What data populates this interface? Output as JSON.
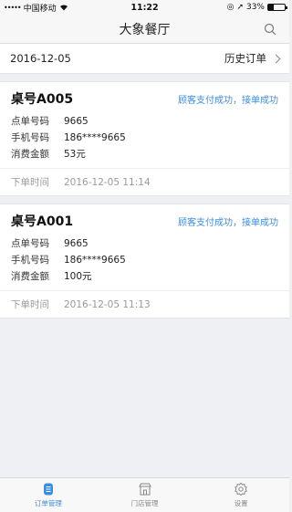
{
  "status_bar": {
    "signal_dots": "•••••",
    "carrier": "中国移动",
    "wifi_icon": "wifi-icon",
    "time": "11:22",
    "battery_percent": "33%",
    "battery_level": 0.33
  },
  "nav": {
    "title": "大象餐厅",
    "search_icon": "search-icon"
  },
  "date_bar": {
    "date": "2016-12-05",
    "history_label": "历史订单"
  },
  "orders": [
    {
      "table_no": "桌号A005",
      "status": "顾客支付成功，接单成功",
      "order_no_label": "点单号码",
      "order_no": "9665",
      "phone_label": "手机号码",
      "phone": "186****9665",
      "amount_label": "消费金额",
      "amount": "53元",
      "time_label": "下单时间",
      "time": "2016-12-05 11:14"
    },
    {
      "table_no": "桌号A001",
      "status": "顾客支付成功，接单成功",
      "order_no_label": "点单号码",
      "order_no": "9665",
      "phone_label": "手机号码",
      "phone": "186****9665",
      "amount_label": "消费金额",
      "amount": "100元",
      "time_label": "下单时间",
      "time": "2016-12-05 11:13"
    }
  ],
  "tabs": [
    {
      "label": "订单管理",
      "icon": "order-list-icon",
      "active": true
    },
    {
      "label": "门店管理",
      "icon": "store-icon",
      "active": false
    },
    {
      "label": "设置",
      "icon": "gear-icon",
      "active": false
    }
  ],
  "colors": {
    "accent": "#3b8de0",
    "background": "#eef0f3"
  }
}
